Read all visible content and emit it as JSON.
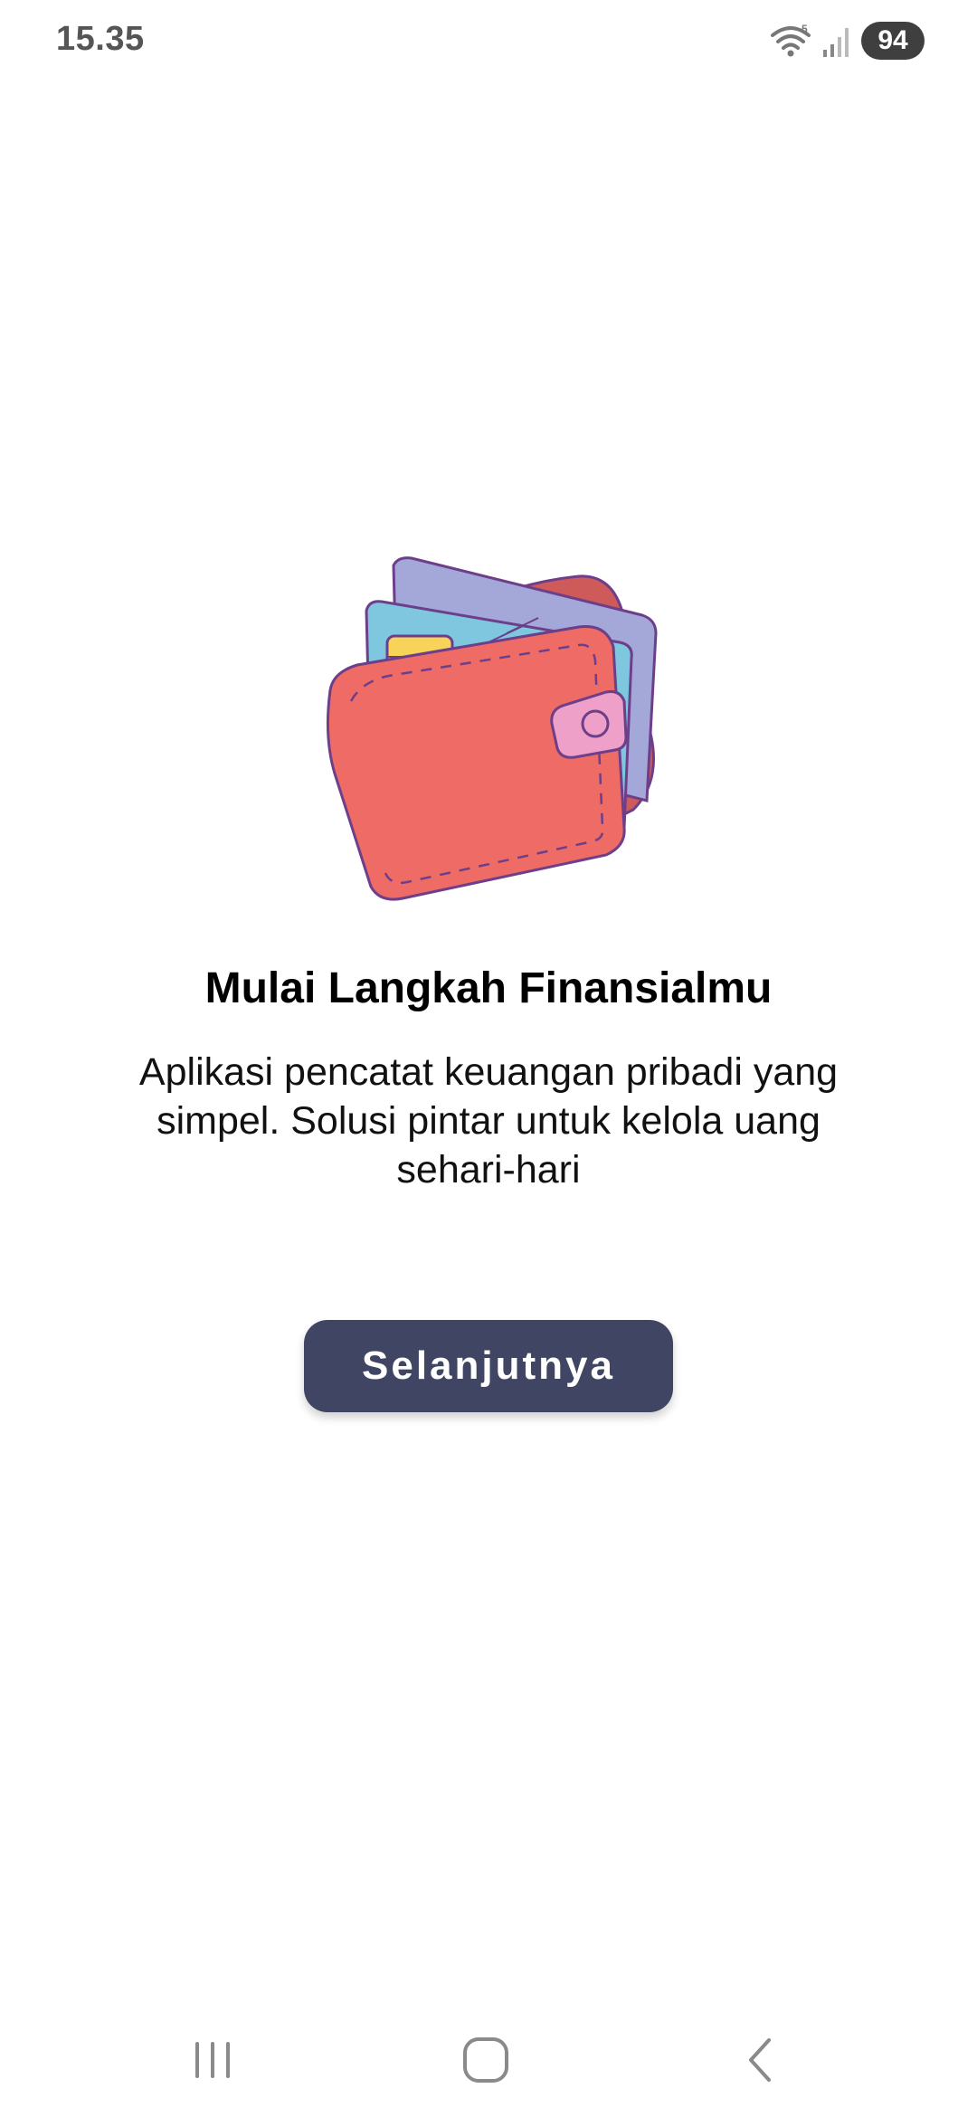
{
  "status_bar": {
    "time": "15.35",
    "battery": "94",
    "icons": [
      "wifi-icon",
      "signal-icon",
      "battery-icon"
    ]
  },
  "illustration": {
    "icon": "wallet-with-cards-illustration"
  },
  "onboarding": {
    "title": "Mulai Langkah Finansialmu",
    "description": "Aplikasi pencatat keuangan pribadi yang simpel. Solusi pintar untuk kelola uang sehari-hari",
    "next_button_label": "Selanjutnya"
  },
  "navigation_bar": {
    "buttons": [
      "recent-apps-icon",
      "home-icon",
      "back-icon"
    ]
  },
  "colors": {
    "button_background": "#3f4562",
    "button_text": "#ffffff",
    "wallet_red": "#ee6b66",
    "card_blue": "#7cc8e0",
    "card_purple": "#a2a9d8"
  }
}
